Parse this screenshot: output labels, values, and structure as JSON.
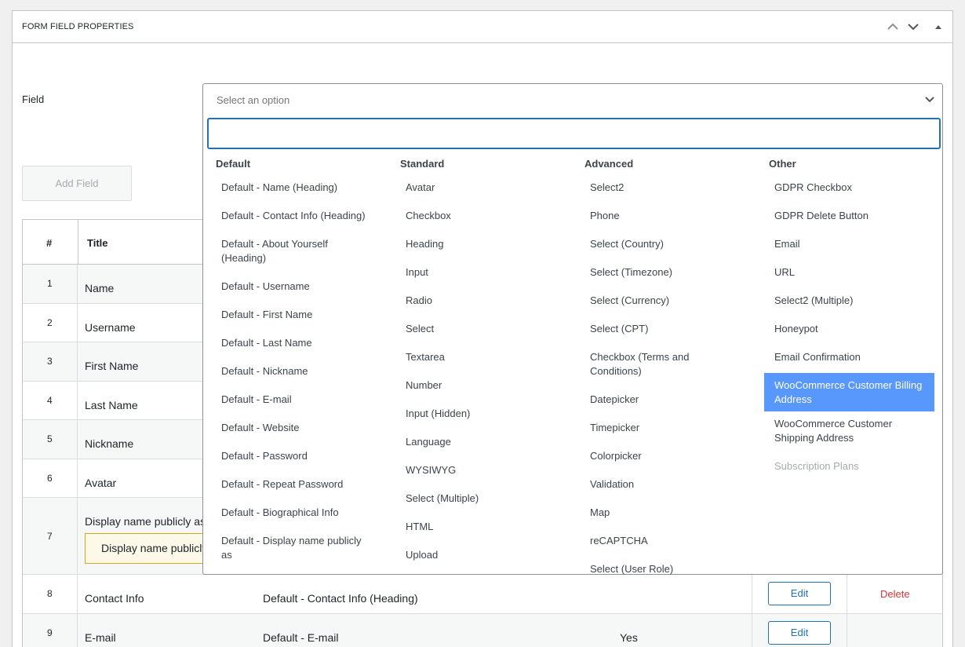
{
  "panel": {
    "title": "FORM FIELD PROPERTIES",
    "icons": [
      "chevron-up-icon",
      "chevron-down-icon",
      "triangle-toggle-icon"
    ]
  },
  "field": {
    "label": "Field",
    "placeholder": "Select an option",
    "search_value": ""
  },
  "add_field_label": "Add Field",
  "table": {
    "headers": {
      "num": "#",
      "title": "Title"
    },
    "rows": [
      {
        "num": "1",
        "title": "Name"
      },
      {
        "num": "2",
        "title": "Username"
      },
      {
        "num": "3",
        "title": "First Name"
      },
      {
        "num": "4",
        "title": "Last Name"
      },
      {
        "num": "5",
        "title": "Nickname"
      },
      {
        "num": "6",
        "title": "Avatar"
      },
      {
        "num": "7",
        "title": "Display name publicly as",
        "notice": "Display name publicly as"
      },
      {
        "num": "8",
        "title": "Contact Info",
        "meta": "Default - Contact Info (Heading)",
        "required": "",
        "edit": "Edit",
        "delete": "Delete"
      },
      {
        "num": "9",
        "title": "E-mail",
        "meta": "Default - E-mail",
        "required": "Yes",
        "edit": "Edit",
        "delete": ""
      }
    ]
  },
  "dropdown": {
    "groups": [
      {
        "label": "Default",
        "options": [
          "Default - Name (Heading)",
          "Default - Contact Info (Heading)",
          "Default - About Yourself (Heading)",
          "Default - Username",
          "Default - First Name",
          "Default - Last Name",
          "Default - Nickname",
          "Default - E-mail",
          "Default - Website",
          "Default - Password",
          "Default - Repeat Password",
          "Default - Biographical Info",
          "Default - Display name publicly as"
        ]
      },
      {
        "label": "Standard",
        "options": [
          "Avatar",
          "Checkbox",
          "Heading",
          "Input",
          "Radio",
          "Select",
          "Textarea",
          "Number",
          "Input (Hidden)",
          "Language",
          "WYSIWYG",
          "Select (Multiple)",
          "HTML",
          "Upload"
        ]
      },
      {
        "label": "Advanced",
        "options": [
          "Select2",
          "Phone",
          "Select (Country)",
          "Select (Timezone)",
          "Select (Currency)",
          "Select (CPT)",
          "Checkbox (Terms and Conditions)",
          "Datepicker",
          "Timepicker",
          "Colorpicker",
          "Validation",
          "Map",
          "reCAPTCHA",
          "Select (User Role)"
        ]
      },
      {
        "label": "Other",
        "options": [
          "GDPR Checkbox",
          "GDPR Delete Button",
          "Email",
          "URL",
          "Select2 (Multiple)",
          "Honeypot",
          "Email Confirmation",
          "WooCommerce Customer Billing Address",
          "WooCommerce Customer Shipping Address",
          "Subscription Plans"
        ],
        "highlighted": "WooCommerce Customer Billing Address",
        "disabled": [
          "Subscription Plans"
        ]
      }
    ]
  },
  "colors": {
    "highlight": "#5897fb",
    "focus_border": "#2271b1",
    "delete": "#d63638",
    "notice_bg": "#fcf9e8"
  }
}
